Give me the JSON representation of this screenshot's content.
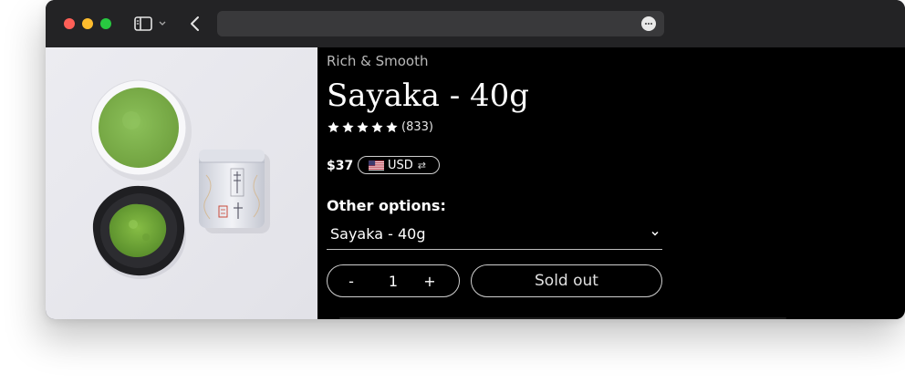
{
  "browser": {
    "traffic_lights": [
      "#fe5f57",
      "#febc2e",
      "#28c840"
    ],
    "icons": [
      "sidebar-icon",
      "chevron-down-icon",
      "back-icon",
      "more-icon"
    ]
  },
  "product": {
    "subtitle": "Rich & Smooth",
    "title": "Sayaka - 40g",
    "rating": 5,
    "review_count": "(833)",
    "price": "$37",
    "currency": "USD",
    "options_label": "Other options:",
    "selected_option": "Sayaka - 40g",
    "quantity": {
      "minus": "-",
      "value": "1",
      "plus": "+"
    },
    "sold_out_label": "Sold out"
  },
  "colors": {
    "page_bg": "#000000",
    "titlebar": "#232325",
    "urlbar": "#39393b",
    "matcha": "#7db04b"
  }
}
